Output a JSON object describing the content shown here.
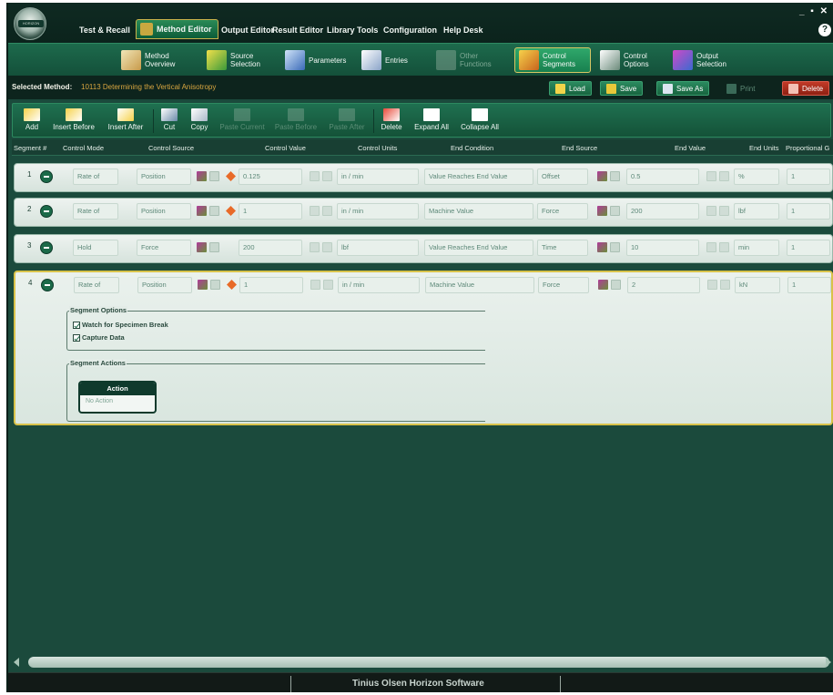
{
  "menu": {
    "items": [
      "Test & Recall",
      "Method Editor",
      "Output Editor",
      "Result Editor",
      "Library Tools",
      "Configuration",
      "Help Desk"
    ],
    "window_controls": "_ ▪ ✕",
    "help": "?"
  },
  "ribbon": {
    "method_overview": "Method Overview",
    "source_selection": "Source Selection",
    "parameters": "Parameters",
    "entries": "Entries",
    "other_functions": "Other Functions",
    "control_segments": "Control Segments",
    "control_options": "Control Options",
    "output_selection": "Output Selection"
  },
  "method_bar": {
    "label": "Selected Method:",
    "value": "10113 Determining the Vertical Anisotropy",
    "load": "Load",
    "save": "Save",
    "save_as": "Save As",
    "print": "Print",
    "delete": "Delete"
  },
  "toolbar": {
    "add": "Add",
    "insert_before": "Insert Before",
    "insert_after": "Insert After",
    "cut": "Cut",
    "copy": "Copy",
    "paste_current": "Paste Current",
    "paste_before": "Paste Before",
    "paste_after": "Paste After",
    "delete": "Delete",
    "expand_all": "Expand All",
    "collapse_all": "Collapse All"
  },
  "columns": [
    "Segment #",
    "Control Mode",
    "Control Source",
    "Control Value",
    "Control Units",
    "End Condition",
    "End Source",
    "End Value",
    "End Units",
    "Proportional G"
  ],
  "segments": [
    {
      "num": "1",
      "mode": "Rate of",
      "source": "Position",
      "value": "0.125",
      "units": "in / min",
      "end_condition": "Value Reaches End Value",
      "end_source": "Offset",
      "end_value": "0.5",
      "end_units": "%",
      "prop": "1"
    },
    {
      "num": "2",
      "mode": "Rate of",
      "source": "Position",
      "value": "1",
      "units": "in / min",
      "end_condition": "Machine Value",
      "end_source": "Force",
      "end_value": "200",
      "end_units": "lbf",
      "prop": "1"
    },
    {
      "num": "3",
      "mode": "Hold",
      "source": "Force",
      "value": "200",
      "units": "lbf",
      "end_condition": "Value Reaches End Value",
      "end_source": "Time",
      "end_value": "10",
      "end_units": "min",
      "prop": "1"
    },
    {
      "num": "4",
      "mode": "Rate of",
      "source": "Position",
      "value": "1",
      "units": "in / min",
      "end_condition": "Machine Value",
      "end_source": "Force",
      "end_value": "2",
      "end_units": "kN",
      "prop": "1"
    }
  ],
  "segment_options": {
    "title": "Segment Options",
    "watch_break": "Watch for Specimen Break",
    "capture_data": "Capture Data"
  },
  "segment_actions": {
    "title": "Segment Actions",
    "header": "Action",
    "value": "No Action"
  },
  "status": {
    "title": "Tinius Olsen Horizon Software"
  },
  "colors": {
    "background": "#1b4a3c",
    "accent_gold": "#d8c24a",
    "delete_red": "#c23a28"
  }
}
